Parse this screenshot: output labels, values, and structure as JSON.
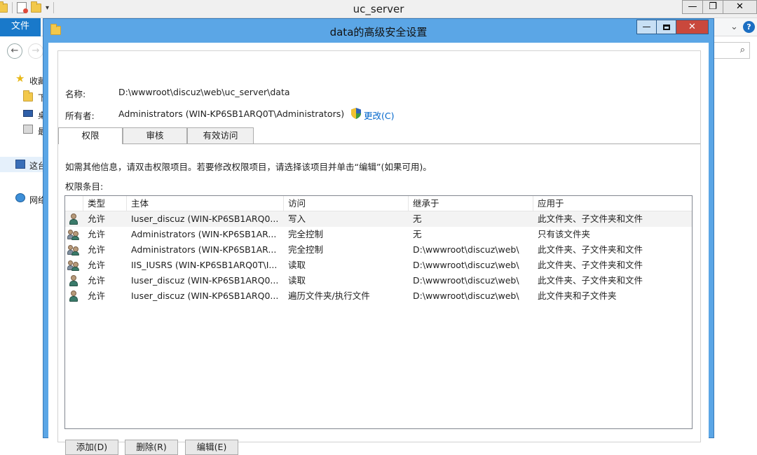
{
  "explorer": {
    "title": "uc_server",
    "controls": {
      "minimize": "—",
      "maximize": "❐",
      "close": "✕"
    },
    "ribbon": {
      "file_tab": "文件",
      "expand_chevron": "⌄",
      "help": "?"
    },
    "nav": {
      "back": "←",
      "forward": "→"
    },
    "search_icon": "⌕",
    "sidebar": [
      {
        "icon": "star-icon",
        "label": "收藏"
      },
      {
        "icon": "downloads-folder-icon",
        "label": "下"
      },
      {
        "icon": "desktop-icon",
        "label": "桌"
      },
      {
        "icon": "recent-places-icon",
        "label": "最"
      },
      {
        "icon": "this-pc-icon",
        "label": "这台"
      },
      {
        "icon": "network-icon",
        "label": "网络"
      }
    ]
  },
  "dialog": {
    "title": "data的高级安全设置",
    "controls": {
      "minimize": "—",
      "close": "✕"
    },
    "name_label": "名称:",
    "name_value": "D:\\wwwroot\\discuz\\web\\uc_server\\data",
    "owner_label": "所有者:",
    "owner_value": "Administrators (WIN-KP6SB1ARQ0T\\Administrators)",
    "change_link": "更改(C)",
    "tabs": [
      {
        "label": "权限",
        "active": true
      },
      {
        "label": "审核",
        "active": false
      },
      {
        "label": "有效访问",
        "active": false
      }
    ],
    "info_text": "如需其他信息，请双击权限项目。若要修改权限项目，请选择该项目并单击“编辑”(如果可用)。",
    "entries_label": "权限条目:",
    "columns": [
      "类型",
      "主体",
      "访问",
      "继承于",
      "应用于"
    ],
    "entries": [
      {
        "icon": "user-icon",
        "type": "允许",
        "principal": "Iuser_discuz (WIN-KP6SB1ARQ0...",
        "access": "写入",
        "inherited_from": "无",
        "applies_to": "此文件夹、子文件夹和文件"
      },
      {
        "icon": "group-icon",
        "type": "允许",
        "principal": "Administrators (WIN-KP6SB1AR...",
        "access": "完全控制",
        "inherited_from": "无",
        "applies_to": "只有该文件夹"
      },
      {
        "icon": "group-icon",
        "type": "允许",
        "principal": "Administrators (WIN-KP6SB1AR...",
        "access": "完全控制",
        "inherited_from": "D:\\wwwroot\\discuz\\web\\",
        "applies_to": "此文件夹、子文件夹和文件"
      },
      {
        "icon": "group-icon",
        "type": "允许",
        "principal": "IIS_IUSRS (WIN-KP6SB1ARQ0T\\I...",
        "access": "读取",
        "inherited_from": "D:\\wwwroot\\discuz\\web\\",
        "applies_to": "此文件夹、子文件夹和文件"
      },
      {
        "icon": "user-icon",
        "type": "允许",
        "principal": "Iuser_discuz (WIN-KP6SB1ARQ0...",
        "access": "读取",
        "inherited_from": "D:\\wwwroot\\discuz\\web\\",
        "applies_to": "此文件夹、子文件夹和文件"
      },
      {
        "icon": "user-icon",
        "type": "允许",
        "principal": "Iuser_discuz (WIN-KP6SB1ARQ0...",
        "access": "遍历文件夹/执行文件",
        "inherited_from": "D:\\wwwroot\\discuz\\web\\",
        "applies_to": "此文件夹和子文件夹"
      }
    ],
    "buttons": {
      "add": "添加(D)",
      "remove": "删除(R)",
      "edit": "编辑(E)"
    }
  },
  "colors": {
    "dialog_frame": "#5ba6e6",
    "file_tab": "#1979ca",
    "close_button": "#c9483c",
    "link": "#0066cc"
  }
}
